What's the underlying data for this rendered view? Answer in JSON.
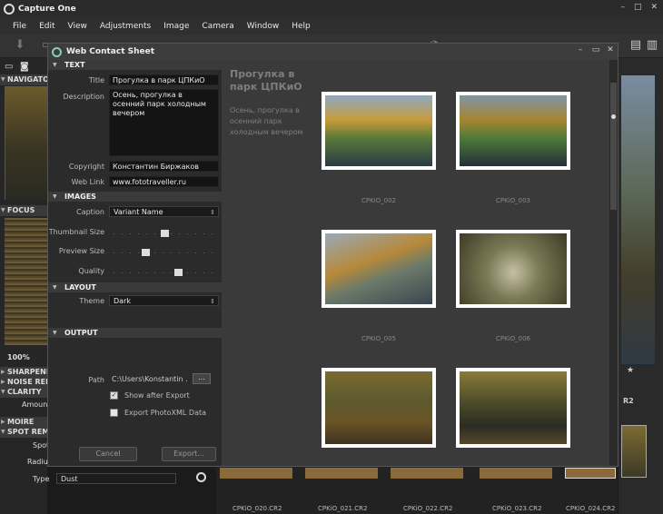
{
  "app": {
    "title": "Capture One",
    "menu": [
      "File",
      "Edit",
      "View",
      "Adjustments",
      "Image",
      "Camera",
      "Window",
      "Help"
    ],
    "left_panel": {
      "navigator": "NAVIGATOR",
      "focus": "FOCUS",
      "zoom": "100%",
      "sections": [
        "SHARPENING",
        "NOISE REDUCTION",
        "CLARITY",
        "MOIRE",
        "SPOT REMOVAL"
      ],
      "amount_label": "Amount",
      "spot_label": "Spot",
      "radius_label": "Radius",
      "type_label": "Type",
      "type_value": "Dust"
    },
    "filmstrip_labels": [
      "CPKiO_020.CR2",
      "CPKiO_021.CR2",
      "CPKiO_022.CR2",
      "CPKiO_023.CR2",
      "CPKiO_024.CR2"
    ],
    "right_label": "R2"
  },
  "dialog": {
    "title": "Web Contact Sheet",
    "sections": {
      "text": "TEXT",
      "images": "IMAGES",
      "layout": "LAYOUT",
      "output": "OUTPUT"
    },
    "text": {
      "title_label": "Title",
      "title_value": "Прогулка в парк ЦПКиО",
      "description_label": "Description",
      "description_value": "Осень, прогулка в осенний парк холодным вечером",
      "copyright_label": "Copyright",
      "copyright_value": "Константин Биржаков",
      "weblink_label": "Web Link",
      "weblink_value": "www.fototraveller.ru"
    },
    "images": {
      "caption_label": "Caption",
      "caption_value": "Variant Name",
      "thumb_size_label": "Thumbnail Size",
      "thumb_size_level": 0.5,
      "preview_size_label": "Preview Size",
      "preview_size_level": 0.3,
      "quality_label": "Quality",
      "quality_level": 0.65
    },
    "layout": {
      "theme_label": "Theme",
      "theme_value": "Dark"
    },
    "output": {
      "path_label": "Path",
      "path_value": "C:\\Users\\Konstantin ...",
      "browse_label": "...",
      "show_after_export_label": "Show after Export",
      "show_after_export_checked": true,
      "export_xml_label": "Export PhotoXML Data",
      "export_xml_checked": false
    },
    "buttons": {
      "cancel": "Cancel",
      "export": "Export..."
    },
    "preview": {
      "title": "Прогулка в парк ЦПКиО",
      "description": "Осень, прогулка в осенний парк холодным вечером",
      "thumbnails": [
        {
          "caption": "CPKiO_002"
        },
        {
          "caption": "CPKiO_003"
        },
        {
          "caption": "CPKiO_005"
        },
        {
          "caption": "CPKiO_006"
        },
        {
          "caption": ""
        },
        {
          "caption": ""
        }
      ]
    }
  }
}
